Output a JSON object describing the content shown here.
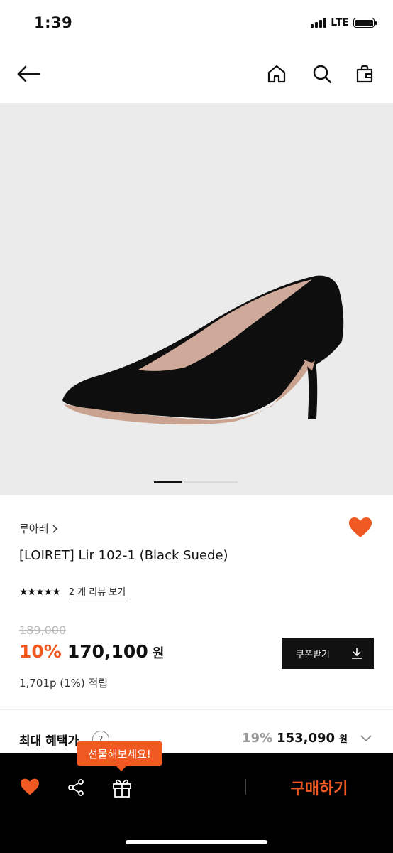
{
  "status_bar": {
    "time": "1:39",
    "network": "LTE"
  },
  "header": {
    "back_icon": "back-arrow-icon",
    "home_icon": "home-icon",
    "search_icon": "search-icon",
    "bag_icon": "shopping-bag-icon"
  },
  "gallery": {
    "slide_index": 1,
    "slide_count": 2
  },
  "product": {
    "brand": "루아레",
    "title": "[LOIRET] Lir 102-1 (Black Suede)",
    "rating": 5,
    "review_link": "2 개 리뷰 보기",
    "original_price": "189,000",
    "discount": "10%",
    "sale_price": "170,100",
    "currency": "원",
    "points": "1,701p (1%) 적립",
    "coupon_label": "쿠폰받기",
    "wishlisted": true
  },
  "benefit": {
    "label": "최대 혜택가",
    "help": "?",
    "rate": "19%",
    "price": "153,090",
    "currency": "원"
  },
  "bottom_bar": {
    "gift_tooltip": "선물해보세요!",
    "buy_label": "구매하기"
  },
  "colors": {
    "accent": "#f05a22",
    "dark": "#111111"
  }
}
